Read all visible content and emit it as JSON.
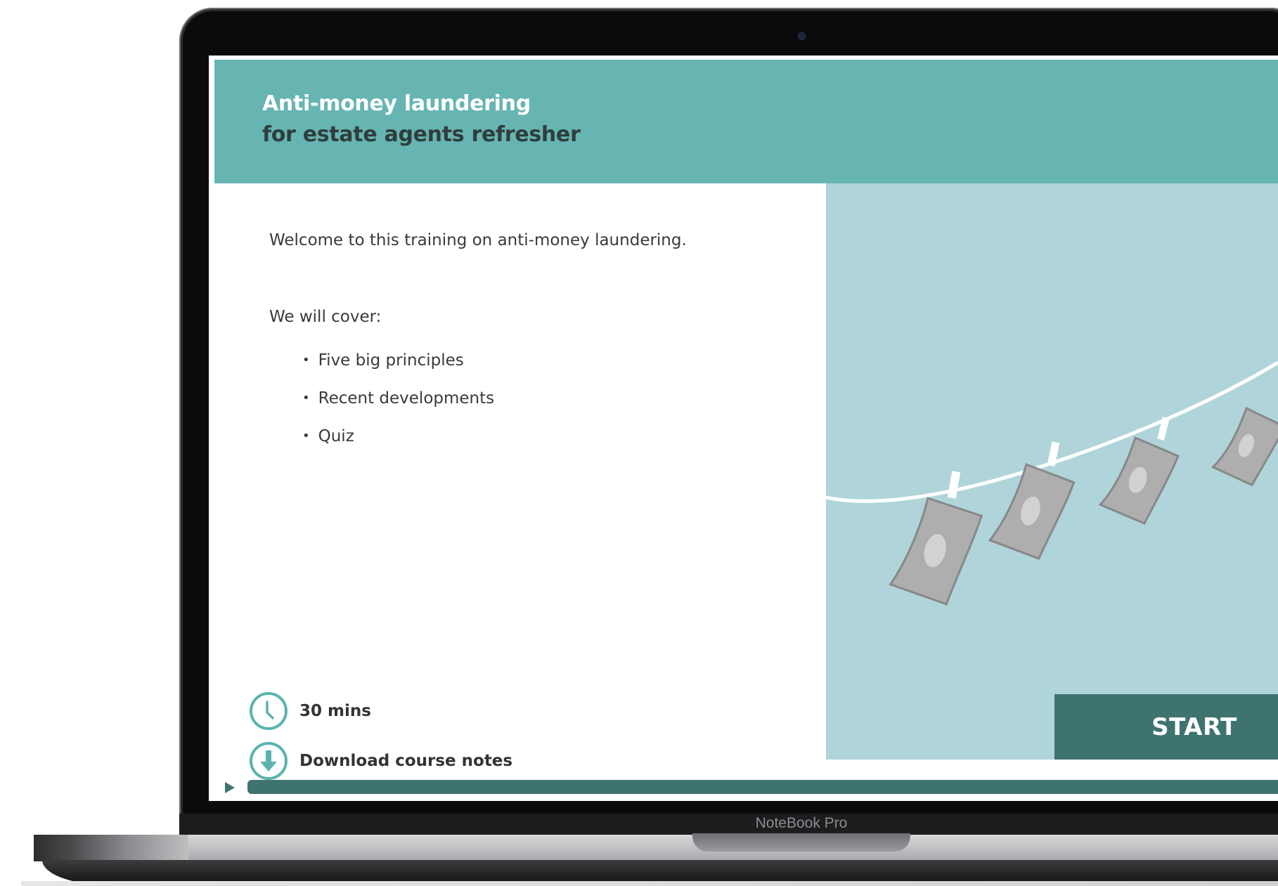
{
  "device": {
    "brand_label": "NoteBook Pro"
  },
  "course": {
    "title_line1": "Anti-money laundering",
    "title_line2": "for estate agents refresher"
  },
  "intro": {
    "welcome": "Welcome to this training on anti-money laundering.",
    "cover_heading": "We will cover:",
    "topics": [
      "Five big principles",
      "Recent developments",
      "Quiz"
    ]
  },
  "meta": {
    "duration_icon": "clock-icon",
    "duration": "30 mins",
    "download_icon": "download-arrow-icon",
    "download": "Download course notes"
  },
  "actions": {
    "start": "START"
  },
  "progress": {
    "play_icon": "play-icon",
    "fraction": 1.0
  },
  "colors": {
    "header_bg": "#66b5b2",
    "accent_dark": "#3f7370",
    "illustration_bg": "#afd5da",
    "icon_teal": "#5bb3ae"
  }
}
